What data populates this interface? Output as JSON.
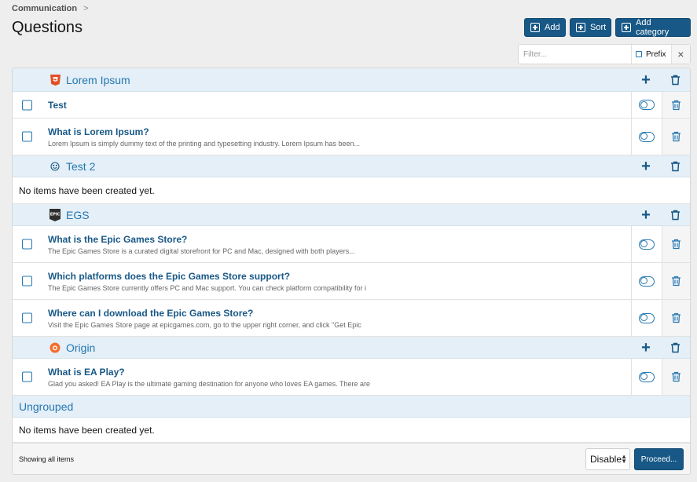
{
  "breadcrumb": {
    "label": "Communication",
    "separator": ">"
  },
  "page_title": "Questions",
  "toolbar": {
    "add_label": "Add",
    "sort_label": "Sort",
    "add_category_label": "Add category"
  },
  "filter": {
    "placeholder": "Filter...",
    "prefix_label": "Prefix",
    "clear_icon": "×"
  },
  "groups": [
    {
      "title": "Lorem Ipsum",
      "icon": "html5-icon",
      "items": [
        {
          "title": "Test",
          "description": ""
        },
        {
          "title": "What is Lorem Ipsum?",
          "description": "Lorem Ipsum is simply dummy text of the printing and typesetting industry. Lorem Ipsum has been..."
        }
      ]
    },
    {
      "title": "Test 2",
      "icon": "smiley-icon",
      "empty_text": "No items have been created yet."
    },
    {
      "title": "EGS",
      "icon": "epic-logo-icon",
      "items": [
        {
          "title": "What is the Epic Games Store?",
          "description": "The Epic Games Store is a curated digital storefront for PC and Mac, designed with both players..."
        },
        {
          "title": "Which platforms does the Epic Games Store support?",
          "description": "The Epic Games Store currently offers PC and Mac support. You can check platform compatibility for i"
        },
        {
          "title": "Where can I download the Epic Games Store?",
          "description": "Visit the Epic Games Store page at epicgames.com, go to the upper right corner, and click \"Get Epic"
        }
      ]
    },
    {
      "title": "Origin",
      "icon": "origin-icon",
      "items": [
        {
          "title": "What is EA Play?",
          "description": "Glad you asked! EA Play is the ultimate gaming destination for anyone who loves EA games. There are"
        }
      ]
    },
    {
      "title": "Ungrouped",
      "empty_text": "No items have been created yet."
    }
  ],
  "footer": {
    "count_text": "Showing all items",
    "action_select": "Disable",
    "proceed_label": "Proceed..."
  },
  "colors": {
    "accent": "#185886",
    "link": "#2577b1",
    "category_bg": "#e4eff7"
  }
}
